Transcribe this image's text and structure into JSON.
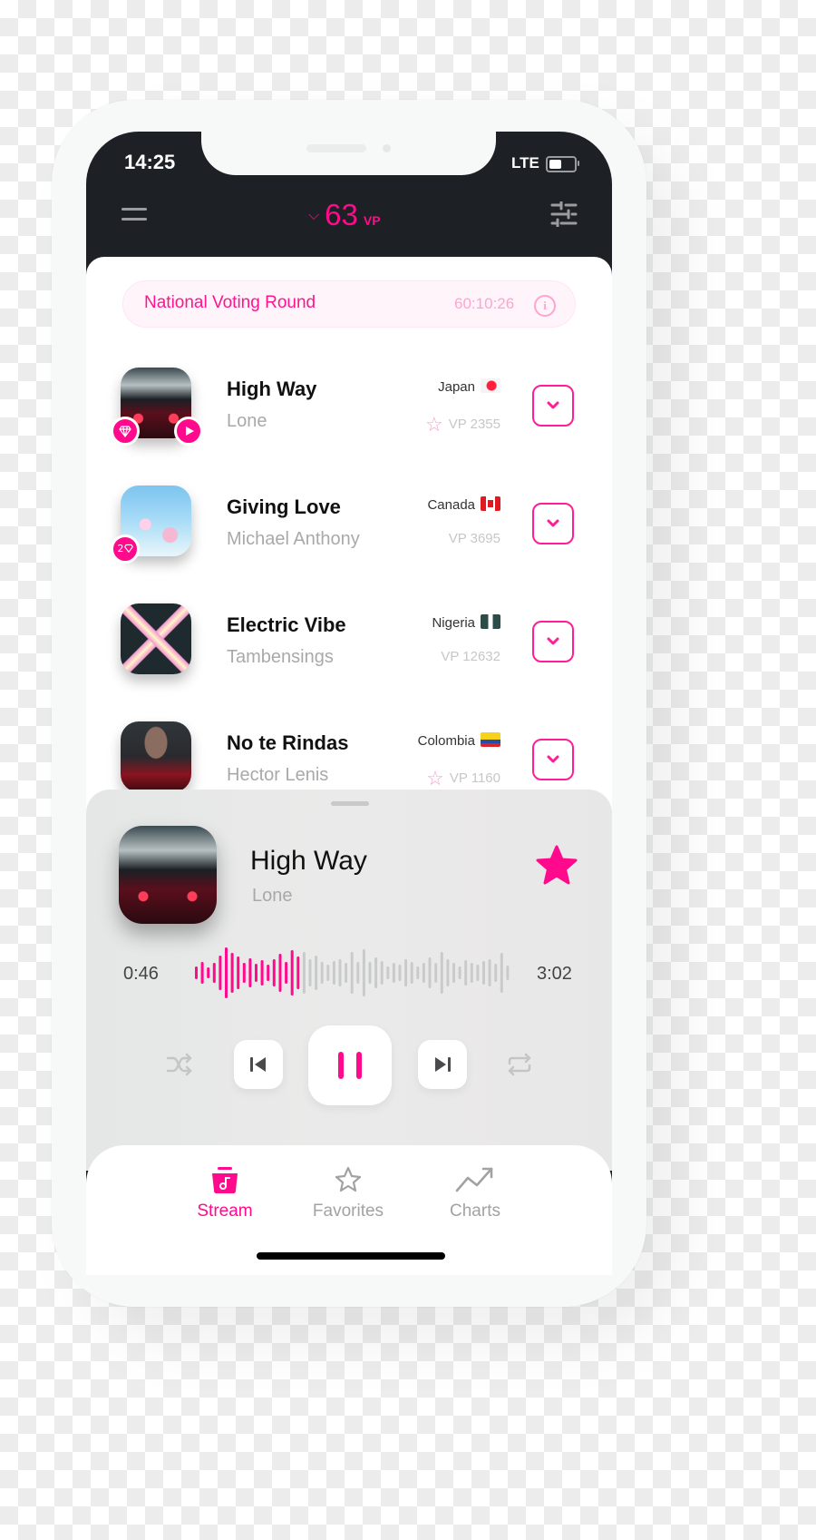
{
  "status_bar": {
    "time": "14:25",
    "network": "LTE",
    "battery_icon": "battery-icon"
  },
  "header": {
    "menu_icon": "hamburger-menu-icon",
    "vp_chevron": "⌄",
    "vp_value": "63",
    "vp_unit": "VP",
    "filter_icon": "sliders-filter-icon"
  },
  "voting_round": {
    "title": "National Voting Round",
    "timer": "60:10:26",
    "info_icon": "i"
  },
  "songs": [
    {
      "title": "High Way",
      "artist": "Lone",
      "country": "Japan",
      "vp": "VP 2355",
      "starred": true,
      "badges": [
        "gem",
        "play"
      ]
    },
    {
      "title": "Giving Love",
      "artist": "Michael Anthony",
      "country": "Canada",
      "vp": "VP 3695",
      "starred": false,
      "badges": [
        "gem-count"
      ],
      "badge_count": "2"
    },
    {
      "title": "Electric Vibe",
      "artist": "Tambensings",
      "country": "Nigeria",
      "vp": "VP 12632",
      "starred": false,
      "badges": []
    },
    {
      "title": "No te Rindas",
      "artist": "Hector Lenis",
      "country": "Colombia",
      "vp": "VP 1160",
      "starred": true,
      "badges": []
    }
  ],
  "player": {
    "title": "High Way",
    "artist": "Lone",
    "favorited": true,
    "elapsed": "0:46",
    "duration": "3:02",
    "progress_fraction": 0.25,
    "is_playing": true
  },
  "tabs": [
    {
      "label": "Stream",
      "icon": "stream-music-icon",
      "active": true
    },
    {
      "label": "Favorites",
      "icon": "star-icon",
      "active": false
    },
    {
      "label": "Charts",
      "icon": "trending-chart-icon",
      "active": false
    }
  ],
  "colors": {
    "accent": "#ff0a8c",
    "header_bg": "#1d2024",
    "inactive": "#a2a2a2"
  }
}
